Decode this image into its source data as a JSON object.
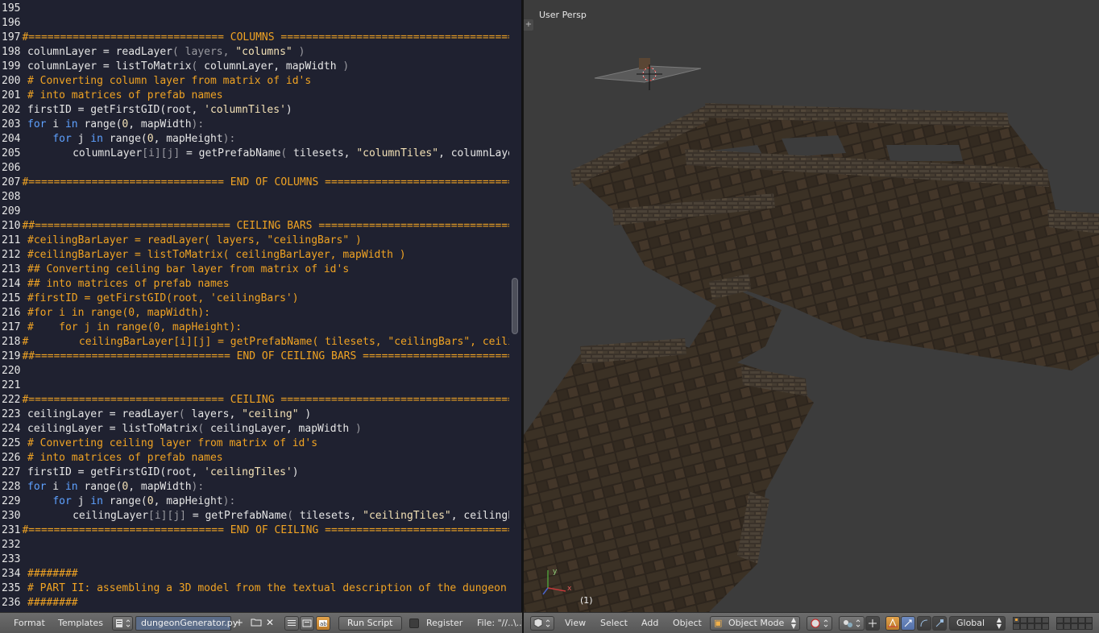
{
  "editor": {
    "lines": [
      {
        "n": "195",
        "t": [
          [
            "",
            ""
          ]
        ]
      },
      {
        "n": "196",
        "t": [
          [
            "",
            ""
          ]
        ]
      },
      {
        "n": "197",
        "t": [
          [
            "c",
            "#=============================== COLUMNS ========================================"
          ]
        ]
      },
      {
        "n": "198",
        "t": [
          [
            "",
            "columnLayer = readLayer"
          ],
          [
            "d",
            "( layers,"
          ],
          [
            "",
            " "
          ],
          [
            "s",
            "\"columns\""
          ],
          [
            "d",
            " )"
          ]
        ]
      },
      {
        "n": "199",
        "t": [
          [
            "",
            "columnLayer = listToMatrix"
          ],
          [
            "d",
            "("
          ],
          [
            "",
            " columnLayer, mapWidth "
          ],
          [
            "d",
            ")"
          ]
        ]
      },
      {
        "n": "200",
        "t": [
          [
            "c",
            "# Converting column layer from matrix of id's"
          ]
        ]
      },
      {
        "n": "201",
        "t": [
          [
            "c",
            "# into matrices of prefab names"
          ]
        ]
      },
      {
        "n": "202",
        "t": [
          [
            "",
            "firstID = getFirstGID(root, "
          ],
          [
            "s",
            "'columnTiles'"
          ],
          [
            "",
            ")"
          ]
        ]
      },
      {
        "n": "203",
        "t": [
          [
            "k",
            "for"
          ],
          [
            "",
            " i "
          ],
          [
            "k",
            "in"
          ],
          [
            "",
            " range("
          ],
          [
            "n",
            "0"
          ],
          [
            "",
            ", mapWidth"
          ],
          [
            "d",
            "):"
          ]
        ]
      },
      {
        "n": "204",
        "t": [
          [
            "",
            "    "
          ],
          [
            "k",
            "for"
          ],
          [
            "",
            " j "
          ],
          [
            "k",
            "in"
          ],
          [
            "",
            " range("
          ],
          [
            "n",
            "0"
          ],
          [
            "",
            ", mapHeight"
          ],
          [
            "d",
            "):"
          ]
        ]
      },
      {
        "n": "205",
        "t": [
          [
            "",
            "        columnLayer"
          ],
          [
            "d",
            "[i][j]"
          ],
          [
            "",
            " = getPrefabName"
          ],
          [
            "d",
            "("
          ],
          [
            "",
            " tilesets, "
          ],
          [
            "s",
            "\"columnTiles\""
          ],
          [
            "",
            ", columnLayer"
          ]
        ]
      },
      {
        "n": "206",
        "t": [
          [
            "",
            ""
          ]
        ]
      },
      {
        "n": "207",
        "t": [
          [
            "c",
            "#=============================== END OF COLUMNS ================================="
          ]
        ]
      },
      {
        "n": "208",
        "t": [
          [
            "",
            ""
          ]
        ]
      },
      {
        "n": "209",
        "t": [
          [
            "",
            ""
          ]
        ]
      },
      {
        "n": "210",
        "t": [
          [
            "c",
            "##=============================== CEILING BARS ===================================="
          ]
        ]
      },
      {
        "n": "211",
        "t": [
          [
            "c",
            "#ceilingBarLayer = readLayer( layers, \"ceilingBars\" )"
          ]
        ]
      },
      {
        "n": "212",
        "t": [
          [
            "c",
            "#ceilingBarLayer = listToMatrix( ceilingBarLayer, mapWidth )"
          ]
        ]
      },
      {
        "n": "213",
        "t": [
          [
            "c",
            "## Converting ceiling bar layer from matrix of id's"
          ]
        ]
      },
      {
        "n": "214",
        "t": [
          [
            "c",
            "## into matrices of prefab names"
          ]
        ]
      },
      {
        "n": "215",
        "t": [
          [
            "c",
            "#firstID = getFirstGID(root, 'ceilingBars')"
          ]
        ]
      },
      {
        "n": "216",
        "t": [
          [
            "c",
            "#for i in range(0, mapWidth):"
          ]
        ]
      },
      {
        "n": "217",
        "t": [
          [
            "c",
            "#    for j in range(0, mapHeight):"
          ]
        ]
      },
      {
        "n": "218",
        "t": [
          [
            "c",
            "#        ceilingBarLayer[i][j] = getPrefabName( tilesets, \"ceilingBars\", ceilingBarLayer"
          ]
        ]
      },
      {
        "n": "219",
        "t": [
          [
            "c",
            "##=============================== END OF CEILING BARS ============================="
          ]
        ]
      },
      {
        "n": "220",
        "t": [
          [
            "",
            ""
          ]
        ]
      },
      {
        "n": "221",
        "t": [
          [
            "",
            ""
          ]
        ]
      },
      {
        "n": "222",
        "t": [
          [
            "c",
            "#=============================== CEILING ========================================"
          ]
        ]
      },
      {
        "n": "223",
        "t": [
          [
            "",
            "ceilingLayer = readLayer"
          ],
          [
            "d",
            "("
          ],
          [
            "",
            " layers, "
          ],
          [
            "s",
            "\"ceiling\""
          ],
          [
            "",
            " )"
          ]
        ]
      },
      {
        "n": "224",
        "t": [
          [
            "",
            "ceilingLayer = listToMatrix"
          ],
          [
            "d",
            "("
          ],
          [
            "",
            " ceilingLayer, mapWidth "
          ],
          [
            "d",
            ")"
          ]
        ]
      },
      {
        "n": "225",
        "t": [
          [
            "c",
            "# Converting ceiling layer from matrix of id's"
          ]
        ]
      },
      {
        "n": "226",
        "t": [
          [
            "c",
            "# into matrices of prefab names"
          ]
        ]
      },
      {
        "n": "227",
        "t": [
          [
            "",
            "firstID = getFirstGID(root, "
          ],
          [
            "s",
            "'ceilingTiles'"
          ],
          [
            "",
            ")"
          ]
        ]
      },
      {
        "n": "228",
        "t": [
          [
            "k",
            "for"
          ],
          [
            "",
            " i "
          ],
          [
            "k",
            "in"
          ],
          [
            "",
            " range("
          ],
          [
            "n",
            "0"
          ],
          [
            "",
            ", mapWidth"
          ],
          [
            "d",
            "):"
          ]
        ]
      },
      {
        "n": "229",
        "t": [
          [
            "",
            "    "
          ],
          [
            "k",
            "for"
          ],
          [
            "",
            " j "
          ],
          [
            "k",
            "in"
          ],
          [
            "",
            " range("
          ],
          [
            "n",
            "0"
          ],
          [
            "",
            ", mapHeight"
          ],
          [
            "d",
            "):"
          ]
        ]
      },
      {
        "n": "230",
        "t": [
          [
            "",
            "        ceilingLayer"
          ],
          [
            "d",
            "[i][j]"
          ],
          [
            "",
            " = getPrefabName"
          ],
          [
            "d",
            "("
          ],
          [
            "",
            " tilesets, "
          ],
          [
            "s",
            "\"ceilingTiles\""
          ],
          [
            "",
            ", ceilingLayer"
          ]
        ]
      },
      {
        "n": "231",
        "t": [
          [
            "c",
            "#=============================== END OF CEILING ================================="
          ]
        ]
      },
      {
        "n": "232",
        "t": [
          [
            "",
            ""
          ]
        ]
      },
      {
        "n": "233",
        "t": [
          [
            "",
            ""
          ]
        ]
      },
      {
        "n": "234",
        "t": [
          [
            "c",
            "########"
          ]
        ]
      },
      {
        "n": "235",
        "t": [
          [
            "c",
            "# PART II: assembling a 3D model from the textual description of the dungeon"
          ]
        ]
      },
      {
        "n": "236",
        "t": [
          [
            "c",
            "########"
          ]
        ]
      }
    ]
  },
  "text_header": {
    "format_label": "Format",
    "templates_label": "Templates",
    "file_name": "dungeonGenerator.py",
    "run_script_label": "Run Script",
    "register_label": "Register",
    "file_path": "File: \"//..\\..\\"
  },
  "viewport": {
    "view_name": "User Persp",
    "frame_label": "(1)",
    "axis_y": "y",
    "axis_x": "x"
  },
  "view_header": {
    "view_label": "View",
    "select_label": "Select",
    "add_label": "Add",
    "object_label": "Object",
    "mode_label": "Object Mode",
    "orientation_label": "Global"
  },
  "icons": [
    "editor-type-icon",
    "text-menu-icon",
    "new-text-icon",
    "open-text-icon",
    "unlink-text-icon",
    "line-numbers-icon",
    "word-wrap-icon",
    "syntax-highlight-icon",
    "viewport-type-icon",
    "object-mode-icon",
    "viewport-shading-icon",
    "pivot-icon",
    "manipulator-icon",
    "translate-icon",
    "rotate-icon",
    "scale-icon",
    "layers-icon"
  ],
  "colors": {
    "editor_bg": "#1f2130",
    "comment": "#f0a323",
    "string": "#f3e1b6",
    "keyword": "#5ea1ff",
    "viewport_bg": "#3c3c3c"
  }
}
